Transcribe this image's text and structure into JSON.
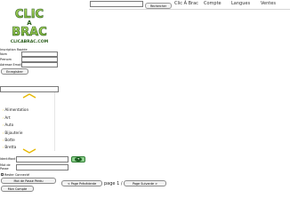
{
  "header": {
    "search_button": "Rechercher",
    "nav": [
      "Clic À Brac",
      "Compte",
      "Langues",
      "Ventes"
    ]
  },
  "logo": {
    "line1": "CLIC",
    "line2": "A",
    "line3": "BRAC",
    "line4": "CLICABRAC.COM"
  },
  "signup": {
    "heading": "Inscription Rapide",
    "fields": [
      {
        "label": "Nom"
      },
      {
        "label": "Prenom"
      },
      {
        "label": "Adresse Email"
      }
    ],
    "submit": "Enregistrer"
  },
  "categories": {
    "items": [
      "Alimentation",
      "Art",
      "Auto",
      "Bijouterie",
      "Botte",
      "Bretta"
    ]
  },
  "login": {
    "id_label": "Identifiant",
    "password_label_line1": "Mot de",
    "password_label_line2": "Passe",
    "remember": "Rester Connecté",
    "forgot_button": "Mot de Passe Perdu",
    "account_button": "Mon Compte"
  },
  "pagination": {
    "prev": "< Page Précédente",
    "status": "page 1 / 0",
    "next": "Page Suivante >"
  },
  "colors": {
    "logo_green": "#8cc63f",
    "logo_dark": "#2a5d1c",
    "chevron": "#e6b800",
    "go_button": "#8fd18f"
  }
}
